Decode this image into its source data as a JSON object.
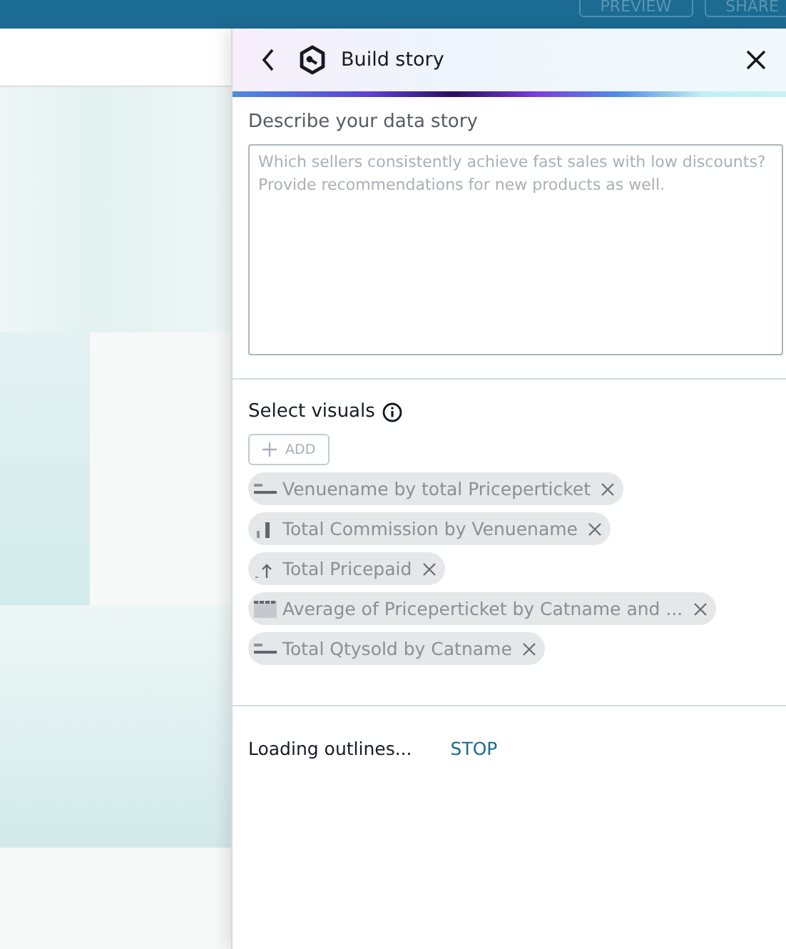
{
  "top_bar": {
    "buttons": [
      "PREVIEW",
      "SHARE"
    ]
  },
  "panel": {
    "title": "Build story",
    "description": {
      "label": "Describe your data story",
      "placeholder": "Which sellers consistently achieve fast sales with low discounts? Provide recommendations for new products as well."
    },
    "visuals": {
      "label": "Select visuals",
      "add_button": {
        "label": "ADD",
        "disabled": true
      },
      "disabled": true,
      "items": [
        {
          "label": "Venuename by total Priceperticket",
          "kind": "horizontal-bar"
        },
        {
          "label": "Total Commission by Venuename",
          "kind": "vertical-bar"
        },
        {
          "label": "Total Pricepaid",
          "kind": "kpi"
        },
        {
          "label": "Average of Priceperticket by Catname and ...",
          "kind": "heatmap"
        },
        {
          "label": "Total Qtysold by Catname",
          "kind": "horizontal-bar"
        }
      ]
    },
    "status": {
      "text": "Loading outlines...",
      "action": "STOP"
    }
  }
}
